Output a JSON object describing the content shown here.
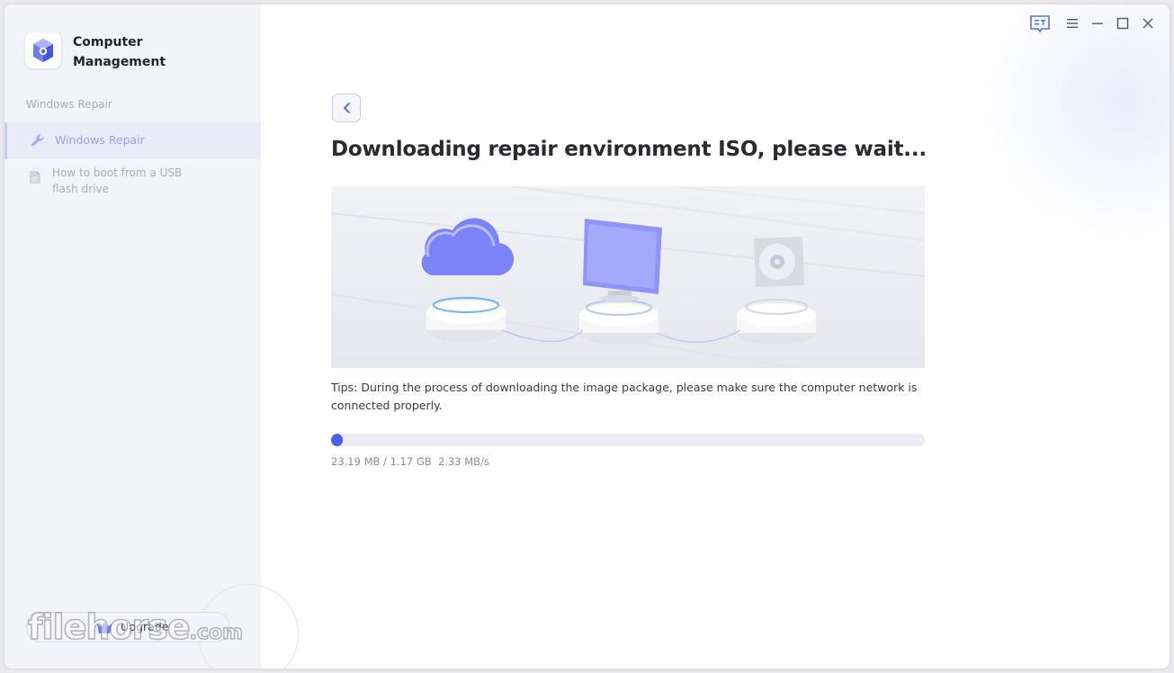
{
  "app": {
    "title": "Computer Management"
  },
  "sidebar": {
    "section_label": "Windows Repair",
    "items": [
      {
        "label": "Windows Repair",
        "active": true,
        "icon": "wrench-icon"
      },
      {
        "label": "How to boot from a USB flash drive",
        "active": false,
        "icon": "document-icon"
      }
    ],
    "upgrade_label": "Upgrade"
  },
  "watermark": {
    "text": "filehorse",
    "suffix": ".com"
  },
  "window_controls": [
    "feedback-icon",
    "menu-icon",
    "minimize-icon",
    "maximize-icon",
    "close-icon"
  ],
  "main": {
    "title": "Downloading repair environment ISO, please wait...",
    "tips": "Tips: During the process of downloading the image package, please make sure the computer network is connected properly.",
    "progress": {
      "fraction": 0.019,
      "downloaded": "23.19 MB / 1.17 GB",
      "speed": "2.33 MB/s"
    }
  },
  "colors": {
    "accent": "#4a5ef3",
    "sidebar_bg": "#f3f4f8",
    "active_label": "#9da2f0"
  }
}
